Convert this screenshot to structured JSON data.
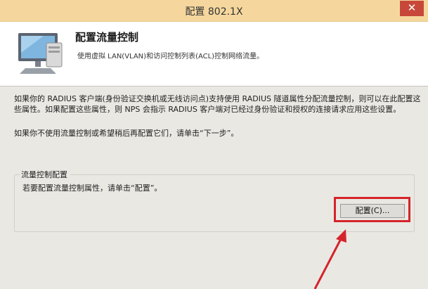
{
  "window": {
    "title": "配置 802.1X",
    "close_glyph": "✕"
  },
  "header": {
    "title": "配置流量控制",
    "description": "使用虚拟 LAN(VLAN)和访问控制列表(ACL)控制网络流量。"
  },
  "body": {
    "paragraph1": "如果你的 RADIUS 客户端(身份验证交换机或无线访问点)支持使用 RADIUS 隧道属性分配流量控制，则可以在此配置这些属性。如果配置这些属性，则 NPS 会指示 RADIUS 客户端对已经过身份验证和授权的连接请求应用这些设置。",
    "paragraph2": "如果你不使用流量控制或希望稍后再配置它们，请单击“下一步”。"
  },
  "group": {
    "legend": "流量控制配置",
    "description": "若要配置流量控制属性，请单击“配置”。",
    "button_label": "配置(C)..."
  },
  "annotation": {
    "highlight_color": "#d4242a"
  }
}
